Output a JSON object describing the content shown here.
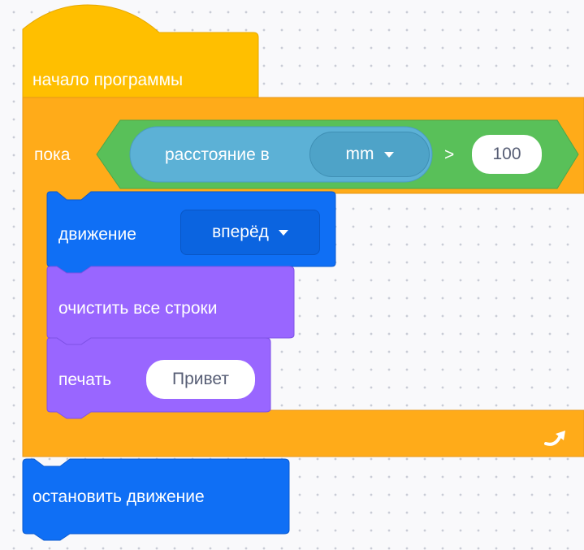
{
  "start_block": {
    "label": "начало программы"
  },
  "while_block": {
    "label": "пока",
    "condition": {
      "sensor_label": "расстояние в",
      "unit": "mm",
      "operator": ">",
      "value": "100"
    }
  },
  "move_block": {
    "label": "движение",
    "direction": "вперёд"
  },
  "clear_block": {
    "label": "очистить все строки"
  },
  "print_block": {
    "label": "печать",
    "text": "Привет"
  },
  "stop_block": {
    "label": "остановить движение"
  },
  "colors": {
    "events": "#ffbf00",
    "control": "#ffab19",
    "operators": "#59c059",
    "sensing": "#5cb1d6",
    "motion": "#0f6ff5",
    "looks": "#9966ff"
  }
}
